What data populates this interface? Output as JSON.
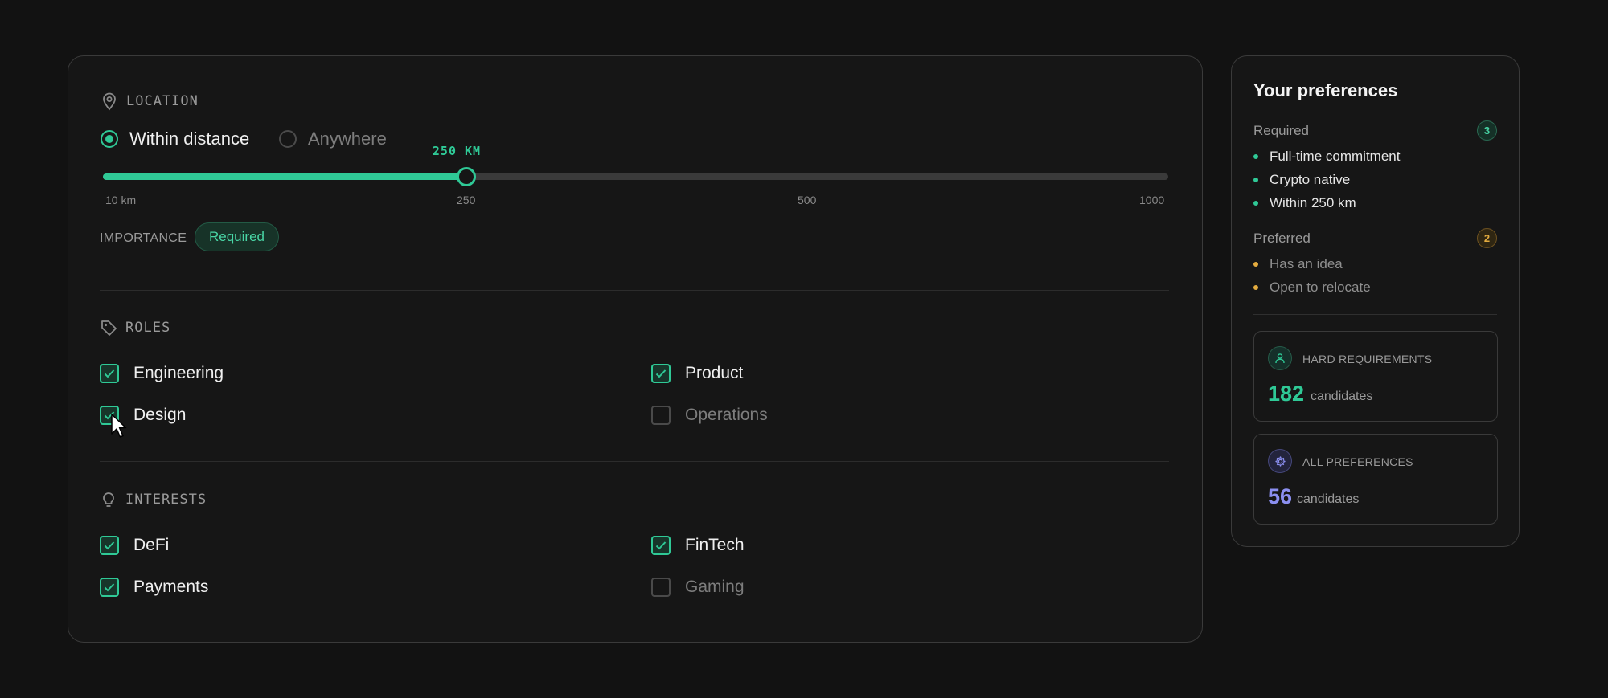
{
  "location": {
    "heading": "LOCATION",
    "options": [
      {
        "label": "Within distance",
        "selected": true
      },
      {
        "label": "Anywhere",
        "selected": false
      }
    ],
    "slider": {
      "value": 250,
      "value_label": "250 KM",
      "min": 10,
      "max": 1000,
      "ticks": [
        "10 km",
        "250",
        "500",
        "1000"
      ]
    },
    "importance_label": "IMPORTANCE",
    "importance_value": "Required"
  },
  "roles": {
    "heading": "ROLES",
    "items": [
      {
        "label": "Engineering",
        "checked": true
      },
      {
        "label": "Product",
        "checked": true
      },
      {
        "label": "Design",
        "checked": true
      },
      {
        "label": "Operations",
        "checked": false
      }
    ]
  },
  "interests": {
    "heading": "INTERESTS",
    "items": [
      {
        "label": "DeFi",
        "checked": true
      },
      {
        "label": "FinTech",
        "checked": true
      },
      {
        "label": "Payments",
        "checked": true
      },
      {
        "label": "Gaming",
        "checked": false
      }
    ]
  },
  "summary": {
    "title": "Your preferences",
    "required": {
      "label": "Required",
      "count": "3",
      "items": [
        "Full-time commitment",
        "Crypto native",
        "Within 250 km"
      ]
    },
    "preferred": {
      "label": "Preferred",
      "count": "2",
      "items": [
        "Has an idea",
        "Open to relocate"
      ]
    },
    "cards": [
      {
        "label": "HARD REQUIREMENTS",
        "count": "182",
        "unit": "candidates",
        "icon": "user-icon",
        "color": "#2fc996"
      },
      {
        "label": "ALL PREFERENCES",
        "count": "56",
        "unit": "candidates",
        "icon": "gear-icon",
        "color": "#8b8ff0"
      }
    ]
  },
  "colors": {
    "accent": "#2fc996",
    "amber": "#e4ac3f",
    "violet": "#8b8ff0",
    "background": "#121212"
  }
}
